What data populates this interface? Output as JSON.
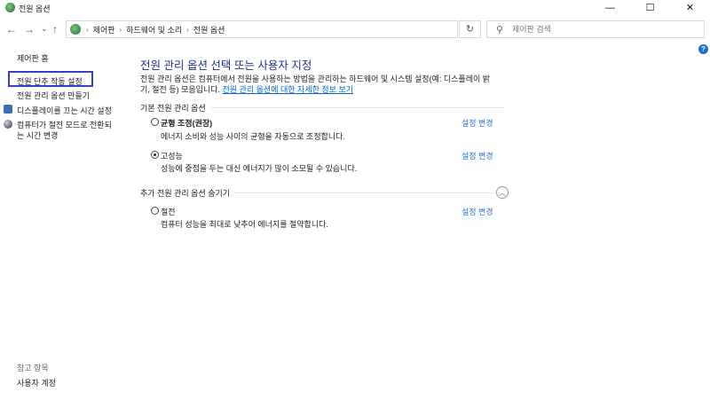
{
  "window": {
    "title": "전원 옵션",
    "minimize": "—",
    "maximize": "☐",
    "close": "✕"
  },
  "nav": {
    "back": "←",
    "forward": "→",
    "recent": "⌄",
    "up": "↑",
    "breadcrumbs": [
      "제어판",
      "하드웨어 및 소리",
      "전원 옵션"
    ],
    "refresh": "↻",
    "search_placeholder": "제어판 검색",
    "help": "?"
  },
  "sidebar": {
    "home": "제어판 홈",
    "items": [
      "전원 단추 작동 설정",
      "전원 관리 옵션 만들기",
      "디스플레이를 끄는 시간 설정",
      "컴퓨터가 절전 모드로 전환되",
      "는 시간 변경"
    ],
    "see_also": "참고 항목",
    "user_accounts": "사용자 계정"
  },
  "main": {
    "title": "전원 관리 옵션 선택 또는 사용자 지정",
    "desc1": "전원 관리 옵션은 컴퓨터에서 전원을 사용하는 방법을 관리하는 하드웨어 및 시스템 설정(예: 디스플레이 밝",
    "desc2": "기, 절전 등) 모음입니다. ",
    "desc_link": "전원 관리 옵션에 대한 자세한 정보 보기",
    "group_basic": "기본 전원 관리 옵션",
    "group_extra": "추가 전원 관리 옵션 숨기기",
    "change": "설정 변경",
    "plans": [
      {
        "name": "균형 조정(권장)",
        "desc": "에너지 소비와 성능 사이의 균형을 자동으로 조정합니다.",
        "selected": false
      },
      {
        "name": "고성능",
        "desc": "성능에 중점을 두는 대신 에너지가 많이 소모될 수 있습니다.",
        "selected": true
      },
      {
        "name": "절전",
        "desc": "컴퓨터 성능을 최대로 낮추어 에너지를 절약합니다.",
        "selected": false
      }
    ]
  }
}
